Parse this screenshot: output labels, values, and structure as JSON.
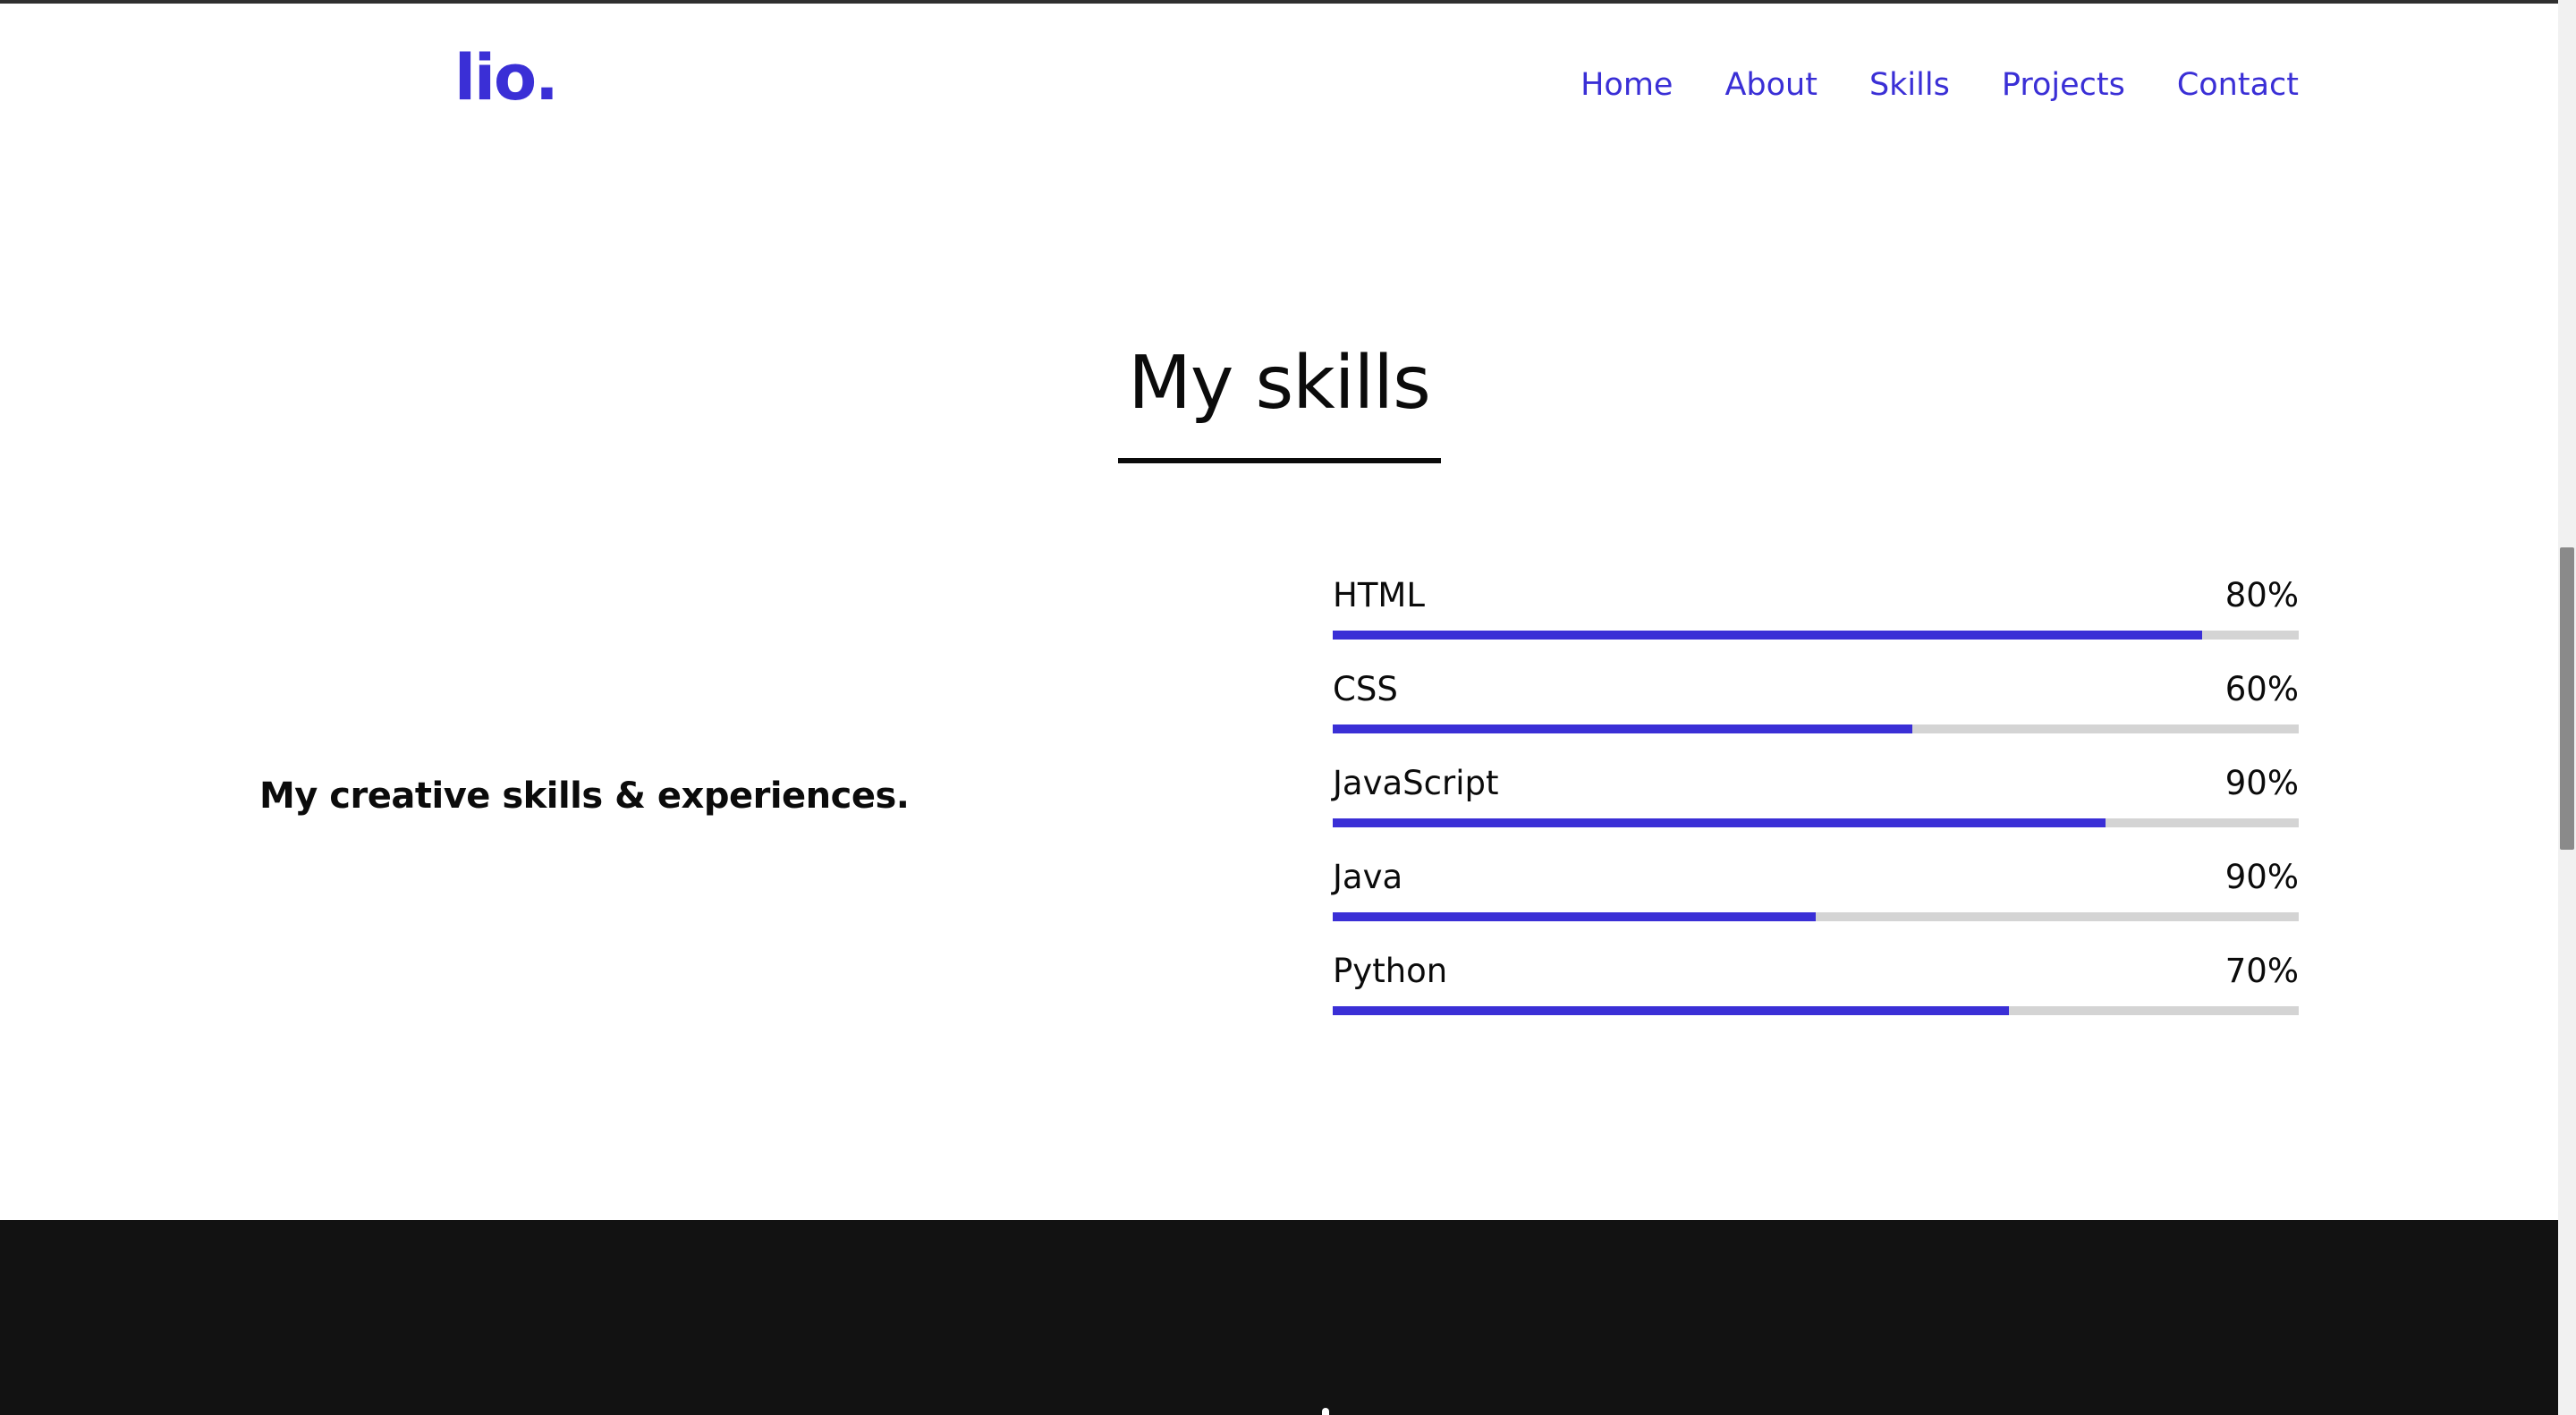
{
  "header": {
    "logo": "lio.",
    "nav": [
      {
        "label": "Home"
      },
      {
        "label": "About"
      },
      {
        "label": "Skills"
      },
      {
        "label": "Projects"
      },
      {
        "label": "Contact"
      }
    ]
  },
  "section": {
    "title": "My skills",
    "tagline": "My creative skills & experiences."
  },
  "skills": [
    {
      "name": "HTML",
      "percent_label": "80%",
      "fill": 0.9
    },
    {
      "name": "CSS",
      "percent_label": "60%",
      "fill": 0.6
    },
    {
      "name": "JavaScript",
      "percent_label": "90%",
      "fill": 0.8
    },
    {
      "name": "Java",
      "percent_label": "90%",
      "fill": 0.5
    },
    {
      "name": "Python",
      "percent_label": "70%",
      "fill": 0.7
    }
  ],
  "colors": {
    "accent": "#3a2fd6",
    "track": "#d4d4d4",
    "text": "#0b0b0b",
    "footer": "#121212"
  }
}
